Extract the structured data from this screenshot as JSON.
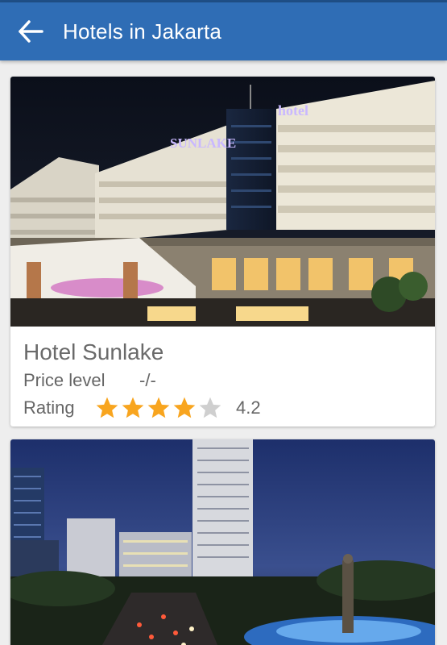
{
  "appbar": {
    "title": "Hotels in Jakarta",
    "back_icon": "arrow-left-icon",
    "color": "#2f6db5"
  },
  "hotels": [
    {
      "image_sign_left": "SUNLAKE",
      "image_sign_right": "hotel",
      "name": "Hotel Sunlake",
      "price_label": "Price level",
      "price_value": "-/-",
      "rating_label": "Rating",
      "rating_value": "4.2",
      "stars_filled": 4,
      "stars_total": 5,
      "star_color": "#f8a51f"
    },
    {
      "image_desc_icon": "city-night-photo"
    }
  ]
}
